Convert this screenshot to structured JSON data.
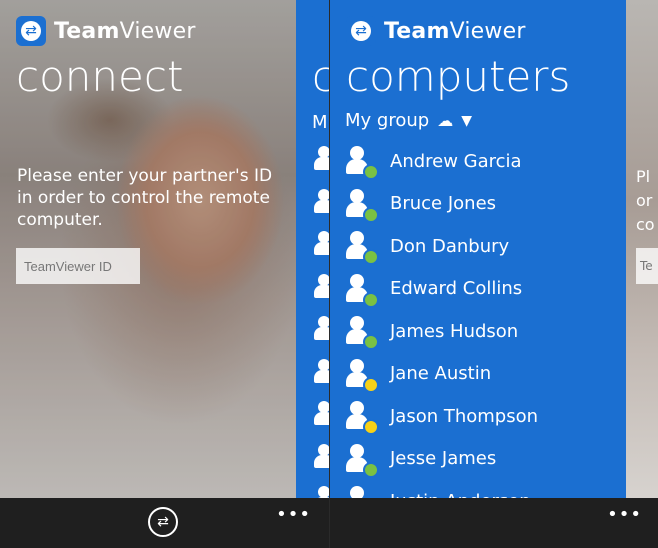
{
  "app": {
    "brand_bold": "Team",
    "brand_light": "Viewer"
  },
  "connect": {
    "title": "connect",
    "instruction": "Please enter your partner's ID in order to control the remote computer.",
    "id_placeholder": "TeamViewer ID",
    "more_label": "•••",
    "peek_title": "c",
    "peek_sub": "M"
  },
  "computers": {
    "title": "computers",
    "group_label": "My group",
    "cloud_icon": "cloud-icon",
    "caret_icon": "caret-down-icon",
    "more_label": "•••",
    "peek_text": "Pl\nor\nco",
    "peek_input": "Te",
    "items": [
      {
        "name": "Andrew Garcia",
        "status": "online"
      },
      {
        "name": "Bruce Jones",
        "status": "online"
      },
      {
        "name": "Don Danbury",
        "status": "online"
      },
      {
        "name": "Edward Collins",
        "status": "online"
      },
      {
        "name": "James Hudson",
        "status": "online"
      },
      {
        "name": "Jane Austin",
        "status": "away"
      },
      {
        "name": "Jason Thompson",
        "status": "away"
      },
      {
        "name": "Jesse James",
        "status": "online"
      },
      {
        "name": "Justin Anderson",
        "status": "online"
      }
    ]
  },
  "colors": {
    "accent_blue": "#1b6fd1",
    "online": "#7ac143",
    "away": "#f7d117",
    "appbar": "#1f1f1f"
  }
}
